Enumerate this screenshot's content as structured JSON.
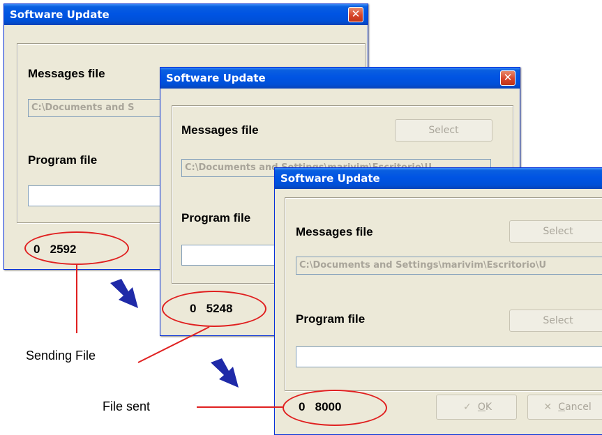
{
  "colors": {
    "titlebar": "#0054e3",
    "dialog": "#ece9d8",
    "callout": "#e02020",
    "arrow": "#1f2aa8"
  },
  "dialogs": [
    {
      "title": "Software Update",
      "messages_label": "Messages file",
      "messages_path": "C:\\Documents and S",
      "program_label": "Program file",
      "counter_a": "0",
      "counter_b": "2592"
    },
    {
      "title": "Software Update",
      "messages_label": "Messages file",
      "select_label": "Select",
      "messages_path": "C:\\Documents and Settings\\marivim\\Escritorio\\U",
      "program_label": "Program file",
      "counter_a": "0",
      "counter_b": "5248"
    },
    {
      "title": "Software Update",
      "messages_label": "Messages file",
      "select_label": "Select",
      "messages_path": "C:\\Documents and Settings\\marivim\\Escritorio\\U",
      "program_label": "Program file",
      "program_select_label": "Select",
      "counter_a": "0",
      "counter_b": "8000",
      "ok_label": "OK",
      "ok_mnemonic": "O",
      "ok_rest": "K",
      "cancel_label": "Cancel",
      "cancel_mnemonic": "C",
      "cancel_rest": "ancel"
    }
  ],
  "annotations": {
    "sending": "Sending File",
    "sent": "File sent"
  },
  "icons": {
    "close": "close-icon",
    "ok": "check-icon",
    "cancel": "x-icon",
    "arrow": "arrow-icon"
  }
}
